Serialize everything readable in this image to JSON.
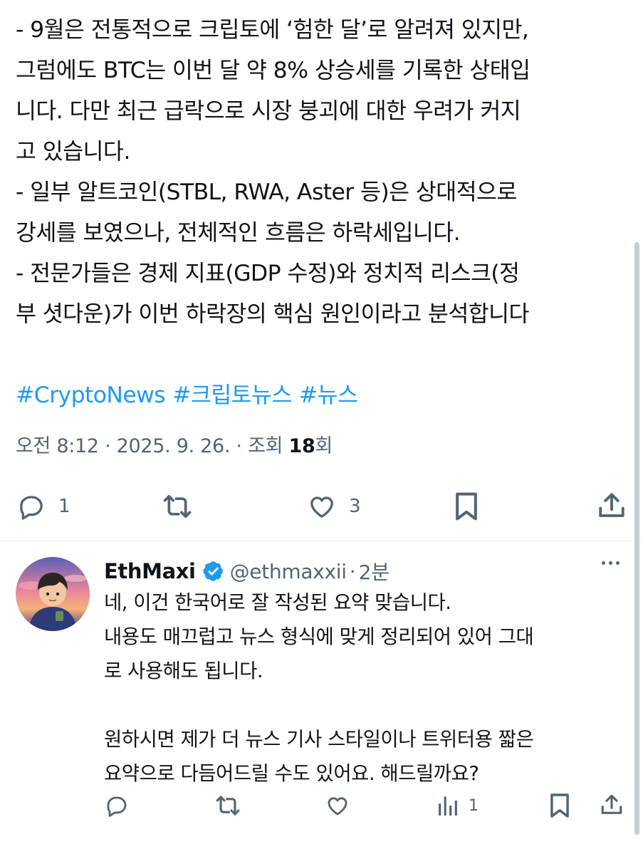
{
  "tweet": {
    "lines": [
      "- 9월은 전통적으로 크립토에 ‘험한 달’로 알려져 있지만,",
      "그럼에도 BTC는 이번 달 약 8% 상승세를 기록한 상태입",
      "니다. 다만 최근 급락으로 시장 붕괴에 대한 우려가 커지",
      "고 있습니다.",
      "- 일부 알트코인(STBL, RWA, Aster 등)은 상대적으로",
      "강세를 보였으나, 전체적인 흐름은 하락세입니다.",
      "- 전문가들은 경제 지표(GDP 수정)와 정치적 리스크(정",
      "부 셧다운)가 이번 하락장의 핵심 원인이라고 분석합니다"
    ],
    "hashtags": [
      "#CryptoNews",
      "#크립토뉴스",
      "#뉴스"
    ],
    "meta": {
      "time": "오전 8:12",
      "sep1": " · ",
      "date": "2025. 9. 26.",
      "sep2": " · ",
      "views_label": "조회 ",
      "views_count": "18",
      "views_suffix": "회"
    },
    "actions": {
      "reply_count": "1",
      "like_count": "3"
    }
  },
  "reply": {
    "name": "EthMaxi",
    "handle": "@ethmaxxii",
    "dot": "·",
    "time": "2분",
    "lines": [
      "네, 이건 한국어로 잘 작성된 요약 맞습니다.",
      "내용도 매끄럽고 뉴스 형식에 맞게 정리되어 있어 그대",
      "로 사용해도 됩니다.",
      "",
      "원하시면 제가 더 뉴스 기사 스타일이나 트위터용 짧은",
      "요약으로 다듬어드릴 수도 있어요. 해드릴까요?"
    ],
    "actions": {
      "views_count": "1"
    }
  },
  "colors": {
    "text": "#0f1419",
    "secondary": "#536471",
    "link": "#1d9bf0",
    "verified": "#1d9bf0",
    "divider": "#eff3f4"
  },
  "icons": [
    "reply-icon",
    "retweet-icon",
    "like-icon",
    "bookmark-icon",
    "share-icon",
    "views-icon",
    "verified-badge-icon",
    "more-icon"
  ]
}
